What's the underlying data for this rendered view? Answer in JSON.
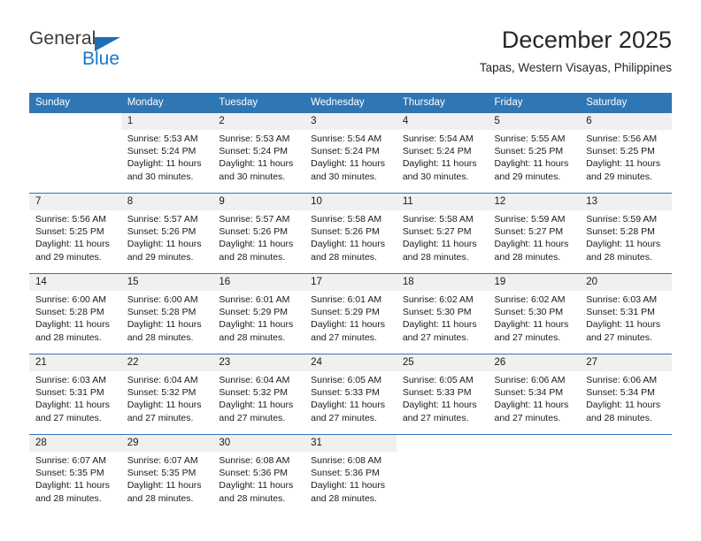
{
  "logo": {
    "primary_text": "General",
    "secondary_text": "Blue",
    "triangle_color": "#1f6fb5",
    "secondary_color": "#1878c8"
  },
  "header": {
    "title": "December 2025",
    "subtitle": "Tapas, Western Visayas, Philippines"
  },
  "theme": {
    "header_bg": "#2f76b5",
    "daynum_bg": "#f0f0f0",
    "separator": "#2f76b5",
    "text": "#1a1a1a"
  },
  "calendar": {
    "weekday_headers": [
      "Sunday",
      "Monday",
      "Tuesday",
      "Wednesday",
      "Thursday",
      "Friday",
      "Saturday"
    ],
    "weeks": [
      [
        {
          "day": "",
          "sunrise": "",
          "sunset": "",
          "daylight": ""
        },
        {
          "day": "1",
          "sunrise": "Sunrise: 5:53 AM",
          "sunset": "Sunset: 5:24 PM",
          "daylight": "Daylight: 11 hours and 30 minutes."
        },
        {
          "day": "2",
          "sunrise": "Sunrise: 5:53 AM",
          "sunset": "Sunset: 5:24 PM",
          "daylight": "Daylight: 11 hours and 30 minutes."
        },
        {
          "day": "3",
          "sunrise": "Sunrise: 5:54 AM",
          "sunset": "Sunset: 5:24 PM",
          "daylight": "Daylight: 11 hours and 30 minutes."
        },
        {
          "day": "4",
          "sunrise": "Sunrise: 5:54 AM",
          "sunset": "Sunset: 5:24 PM",
          "daylight": "Daylight: 11 hours and 30 minutes."
        },
        {
          "day": "5",
          "sunrise": "Sunrise: 5:55 AM",
          "sunset": "Sunset: 5:25 PM",
          "daylight": "Daylight: 11 hours and 29 minutes."
        },
        {
          "day": "6",
          "sunrise": "Sunrise: 5:56 AM",
          "sunset": "Sunset: 5:25 PM",
          "daylight": "Daylight: 11 hours and 29 minutes."
        }
      ],
      [
        {
          "day": "7",
          "sunrise": "Sunrise: 5:56 AM",
          "sunset": "Sunset: 5:25 PM",
          "daylight": "Daylight: 11 hours and 29 minutes."
        },
        {
          "day": "8",
          "sunrise": "Sunrise: 5:57 AM",
          "sunset": "Sunset: 5:26 PM",
          "daylight": "Daylight: 11 hours and 29 minutes."
        },
        {
          "day": "9",
          "sunrise": "Sunrise: 5:57 AM",
          "sunset": "Sunset: 5:26 PM",
          "daylight": "Daylight: 11 hours and 28 minutes."
        },
        {
          "day": "10",
          "sunrise": "Sunrise: 5:58 AM",
          "sunset": "Sunset: 5:26 PM",
          "daylight": "Daylight: 11 hours and 28 minutes."
        },
        {
          "day": "11",
          "sunrise": "Sunrise: 5:58 AM",
          "sunset": "Sunset: 5:27 PM",
          "daylight": "Daylight: 11 hours and 28 minutes."
        },
        {
          "day": "12",
          "sunrise": "Sunrise: 5:59 AM",
          "sunset": "Sunset: 5:27 PM",
          "daylight": "Daylight: 11 hours and 28 minutes."
        },
        {
          "day": "13",
          "sunrise": "Sunrise: 5:59 AM",
          "sunset": "Sunset: 5:28 PM",
          "daylight": "Daylight: 11 hours and 28 minutes."
        }
      ],
      [
        {
          "day": "14",
          "sunrise": "Sunrise: 6:00 AM",
          "sunset": "Sunset: 5:28 PM",
          "daylight": "Daylight: 11 hours and 28 minutes."
        },
        {
          "day": "15",
          "sunrise": "Sunrise: 6:00 AM",
          "sunset": "Sunset: 5:28 PM",
          "daylight": "Daylight: 11 hours and 28 minutes."
        },
        {
          "day": "16",
          "sunrise": "Sunrise: 6:01 AM",
          "sunset": "Sunset: 5:29 PM",
          "daylight": "Daylight: 11 hours and 28 minutes."
        },
        {
          "day": "17",
          "sunrise": "Sunrise: 6:01 AM",
          "sunset": "Sunset: 5:29 PM",
          "daylight": "Daylight: 11 hours and 27 minutes."
        },
        {
          "day": "18",
          "sunrise": "Sunrise: 6:02 AM",
          "sunset": "Sunset: 5:30 PM",
          "daylight": "Daylight: 11 hours and 27 minutes."
        },
        {
          "day": "19",
          "sunrise": "Sunrise: 6:02 AM",
          "sunset": "Sunset: 5:30 PM",
          "daylight": "Daylight: 11 hours and 27 minutes."
        },
        {
          "day": "20",
          "sunrise": "Sunrise: 6:03 AM",
          "sunset": "Sunset: 5:31 PM",
          "daylight": "Daylight: 11 hours and 27 minutes."
        }
      ],
      [
        {
          "day": "21",
          "sunrise": "Sunrise: 6:03 AM",
          "sunset": "Sunset: 5:31 PM",
          "daylight": "Daylight: 11 hours and 27 minutes."
        },
        {
          "day": "22",
          "sunrise": "Sunrise: 6:04 AM",
          "sunset": "Sunset: 5:32 PM",
          "daylight": "Daylight: 11 hours and 27 minutes."
        },
        {
          "day": "23",
          "sunrise": "Sunrise: 6:04 AM",
          "sunset": "Sunset: 5:32 PM",
          "daylight": "Daylight: 11 hours and 27 minutes."
        },
        {
          "day": "24",
          "sunrise": "Sunrise: 6:05 AM",
          "sunset": "Sunset: 5:33 PM",
          "daylight": "Daylight: 11 hours and 27 minutes."
        },
        {
          "day": "25",
          "sunrise": "Sunrise: 6:05 AM",
          "sunset": "Sunset: 5:33 PM",
          "daylight": "Daylight: 11 hours and 27 minutes."
        },
        {
          "day": "26",
          "sunrise": "Sunrise: 6:06 AM",
          "sunset": "Sunset: 5:34 PM",
          "daylight": "Daylight: 11 hours and 27 minutes."
        },
        {
          "day": "27",
          "sunrise": "Sunrise: 6:06 AM",
          "sunset": "Sunset: 5:34 PM",
          "daylight": "Daylight: 11 hours and 28 minutes."
        }
      ],
      [
        {
          "day": "28",
          "sunrise": "Sunrise: 6:07 AM",
          "sunset": "Sunset: 5:35 PM",
          "daylight": "Daylight: 11 hours and 28 minutes."
        },
        {
          "day": "29",
          "sunrise": "Sunrise: 6:07 AM",
          "sunset": "Sunset: 5:35 PM",
          "daylight": "Daylight: 11 hours and 28 minutes."
        },
        {
          "day": "30",
          "sunrise": "Sunrise: 6:08 AM",
          "sunset": "Sunset: 5:36 PM",
          "daylight": "Daylight: 11 hours and 28 minutes."
        },
        {
          "day": "31",
          "sunrise": "Sunrise: 6:08 AM",
          "sunset": "Sunset: 5:36 PM",
          "daylight": "Daylight: 11 hours and 28 minutes."
        },
        {
          "day": "",
          "sunrise": "",
          "sunset": "",
          "daylight": ""
        },
        {
          "day": "",
          "sunrise": "",
          "sunset": "",
          "daylight": ""
        },
        {
          "day": "",
          "sunrise": "",
          "sunset": "",
          "daylight": ""
        }
      ]
    ]
  }
}
